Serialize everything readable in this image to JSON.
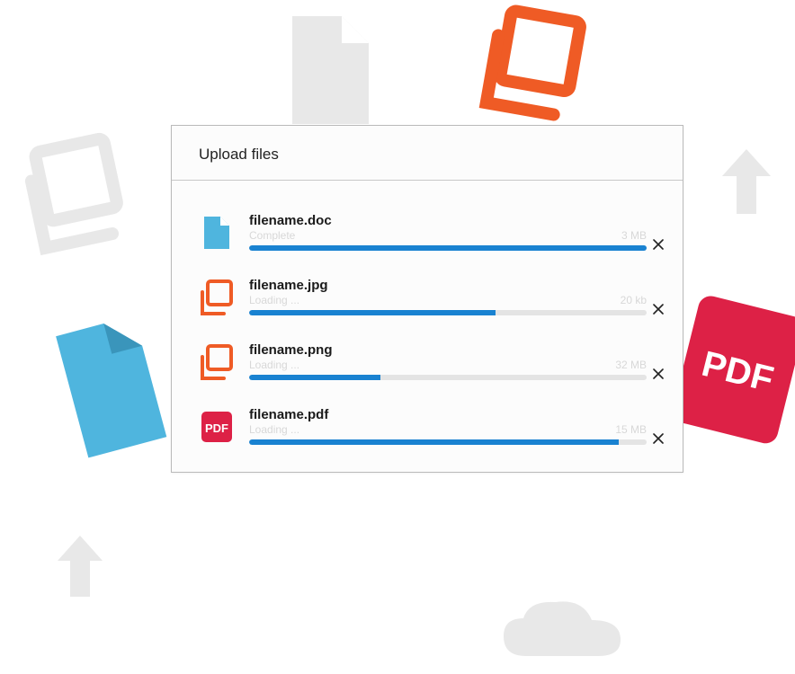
{
  "dialog": {
    "title": "Upload files",
    "files": [
      {
        "name": "filename.doc",
        "status": "Complete",
        "size": "3 MB",
        "progress": 100,
        "icon": "doc"
      },
      {
        "name": "filename.jpg",
        "status": "Loading ...",
        "size": "20 kb",
        "progress": 62,
        "icon": "image"
      },
      {
        "name": "filename.png",
        "status": "Loading ...",
        "size": "32 MB",
        "progress": 33,
        "icon": "image"
      },
      {
        "name": "filename.pdf",
        "status": "Loading ...",
        "size": "15 MB",
        "progress": 93,
        "icon": "pdf"
      }
    ]
  },
  "colors": {
    "doc": "#4fb5de",
    "image": "#ef5b25",
    "pdf": "#dd2146",
    "progress": "#1982d1",
    "decorGray": "#e8e8e8"
  }
}
